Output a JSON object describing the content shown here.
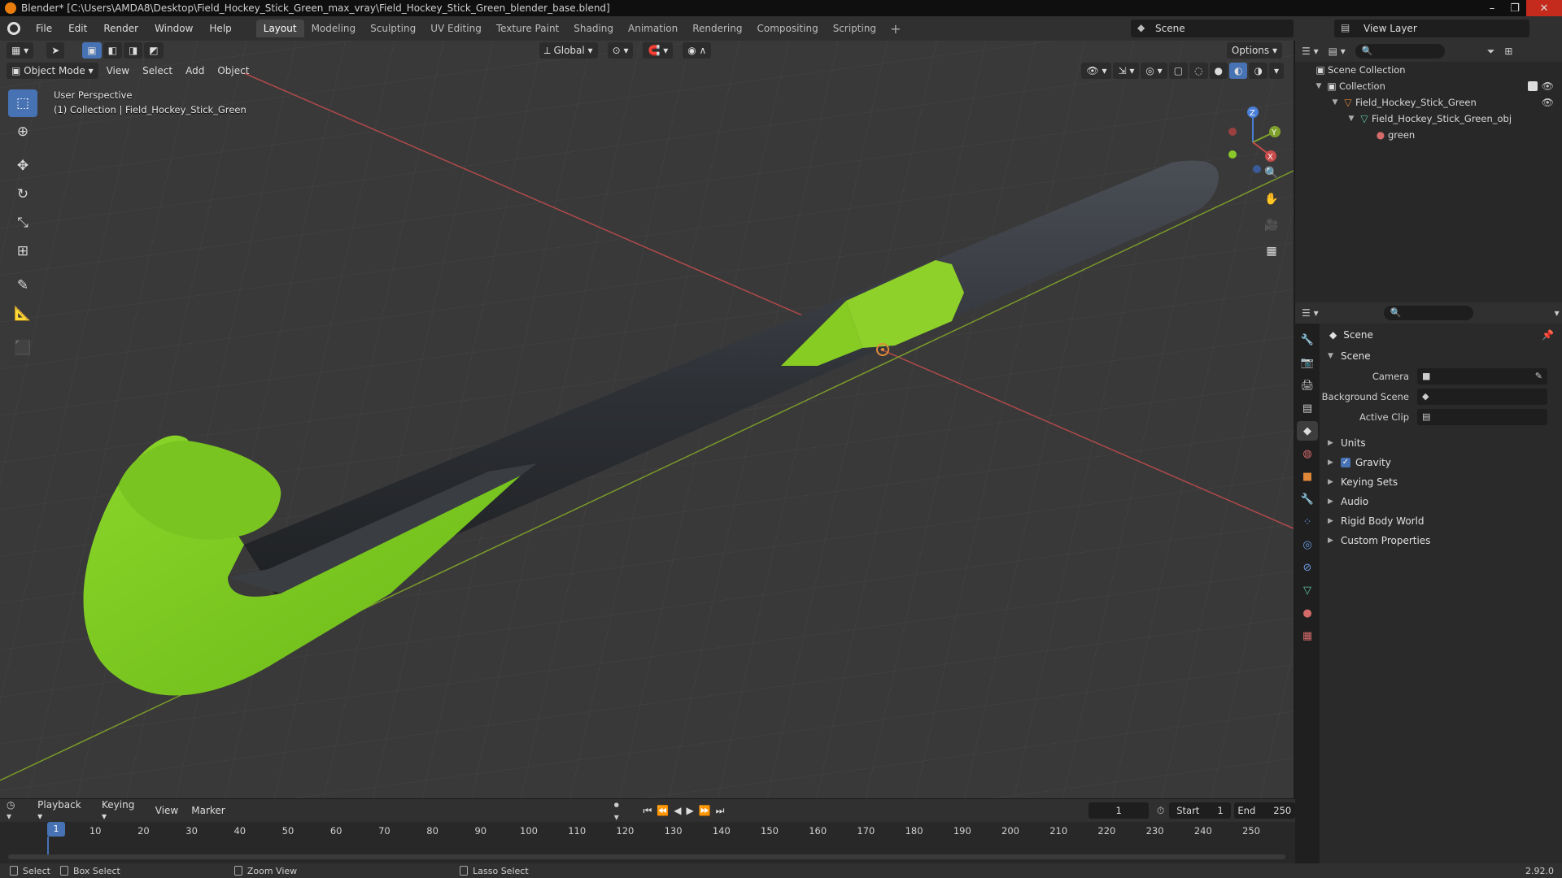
{
  "window": {
    "title": "Blender* [C:\\Users\\AMDA8\\Desktop\\Field_Hockey_Stick_Green_max_vray\\Field_Hockey_Stick_Green_blender_base.blend]"
  },
  "menu": [
    "File",
    "Edit",
    "Render",
    "Window",
    "Help"
  ],
  "workspaces": [
    "Layout",
    "Modeling",
    "Sculpting",
    "UV Editing",
    "Texture Paint",
    "Shading",
    "Animation",
    "Rendering",
    "Compositing",
    "Scripting"
  ],
  "scene_selector": "Scene",
  "view_layer_selector": "View Layer",
  "viewport": {
    "mode": "Object Mode",
    "menus": [
      "View",
      "Select",
      "Add",
      "Object"
    ],
    "orientation": "Global",
    "options_label": "Options",
    "info_line1": "User Perspective",
    "info_line2": "(1) Collection | Field_Hockey_Stick_Green",
    "axes": {
      "x": "X",
      "y": "Y",
      "z": "Z"
    },
    "colors": {
      "green": "#7fd21a",
      "dark": "#2c2f33",
      "x_axis": "#c84b4b",
      "y_axis": "#7ea02a"
    }
  },
  "outliner": {
    "root": "Scene Collection",
    "items": [
      {
        "label": "Collection"
      },
      {
        "label": "Field_Hockey_Stick_Green"
      },
      {
        "label": "Field_Hockey_Stick_Green_obj"
      },
      {
        "label": "green"
      }
    ]
  },
  "properties": {
    "title": "Scene",
    "panel": "Scene",
    "fields": [
      {
        "label": "Camera"
      },
      {
        "label": "Background Scene"
      },
      {
        "label": "Active Clip"
      }
    ],
    "collapsed_panels": [
      "Units",
      "Gravity",
      "Keying Sets",
      "Audio",
      "Rigid Body World",
      "Custom Properties"
    ]
  },
  "timeline": {
    "menus": [
      "Playback",
      "Keying",
      "View",
      "Marker"
    ],
    "current_frame": "1",
    "start_label": "Start",
    "start": "1",
    "end_label": "End",
    "end": "250",
    "ticks": [
      "1",
      "10",
      "20",
      "30",
      "40",
      "50",
      "60",
      "70",
      "80",
      "90",
      "100",
      "110",
      "120",
      "130",
      "140",
      "150",
      "160",
      "170",
      "180",
      "190",
      "200",
      "210",
      "220",
      "230",
      "240",
      "250"
    ]
  },
  "statusbar": {
    "items": [
      "Select",
      "Box Select",
      "Zoom View",
      "Lasso Select"
    ],
    "version": "2.92.0"
  }
}
